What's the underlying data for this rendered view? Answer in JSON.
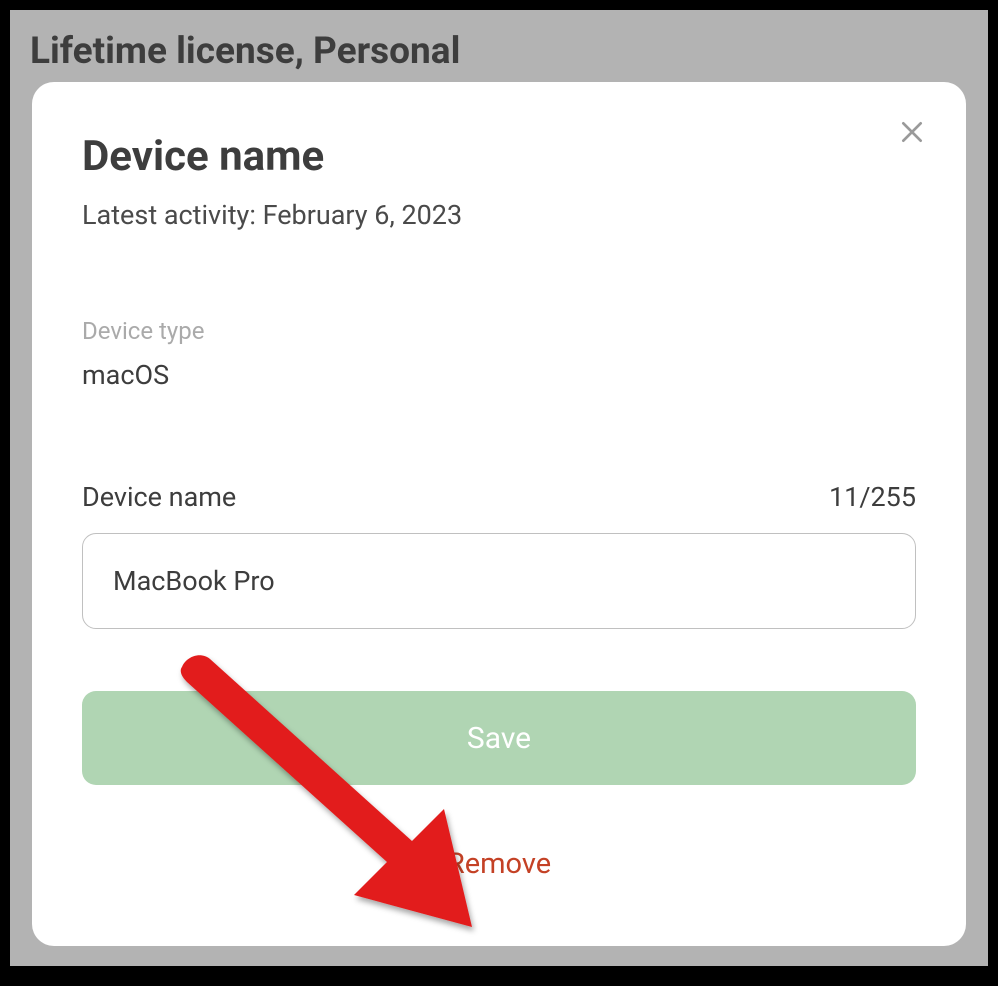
{
  "page": {
    "title": "Lifetime license, Personal"
  },
  "modal": {
    "title": "Device name",
    "latest_activity_label": "Latest activity: ",
    "latest_activity_date": "February 6, 2023",
    "device_type_label": "Device type",
    "device_type_value": "macOS",
    "device_name_label": "Device name",
    "char_count": "11/255",
    "device_name_value": "MacBook Pro",
    "save_label": "Save",
    "remove_label": "Remove"
  }
}
